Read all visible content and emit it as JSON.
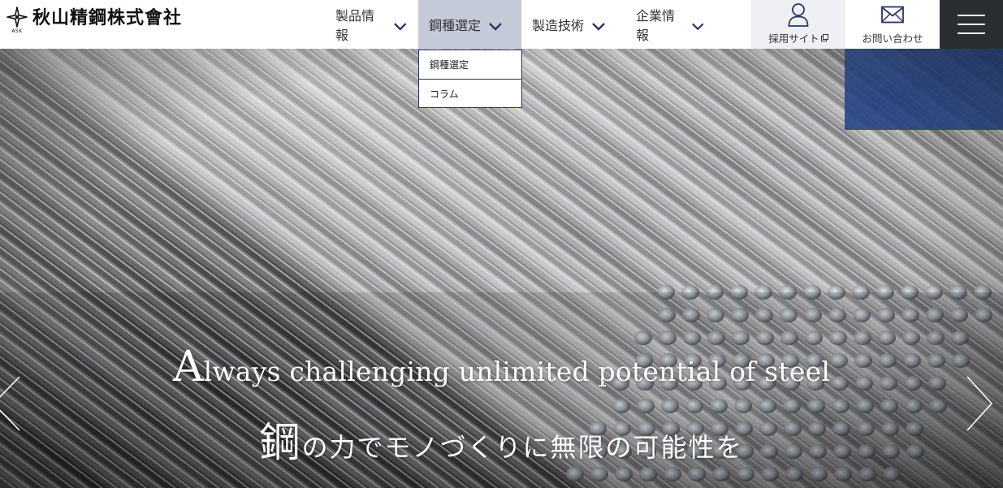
{
  "brand": {
    "abbr": "ASK",
    "name": "秋山精鋼株式會社"
  },
  "nav": {
    "items": [
      {
        "label": "製品情報"
      },
      {
        "label": "鋼種選定"
      },
      {
        "label": "製造技術"
      },
      {
        "label": "企業情報"
      }
    ],
    "active_index": 1
  },
  "dropdown": {
    "items": [
      {
        "label": "鋼種選定"
      },
      {
        "label": "コラム"
      }
    ]
  },
  "utility": {
    "recruit_label": "採用サイト",
    "contact_label": "お問い合わせ"
  },
  "hero": {
    "tagline_en_cap": "A",
    "tagline_en_rest": "lways challenging unlimited potential of steel",
    "tagline_jp_cap": "鋼",
    "tagline_jp_rest": "の力でモノづくりに無限の可能性を"
  },
  "icons": {
    "nav_chevron": "chevron-down-icon",
    "recruit": "user-icon",
    "contact": "mail-icon",
    "external": "external-link-icon",
    "menu": "hamburger-menu-icon",
    "prev": "chevron-left-icon",
    "next": "chevron-right-icon"
  },
  "colors": {
    "nav_active_bg": "#c4cad8",
    "dropdown_border": "#2b3466",
    "menu_bg": "#2a2e33",
    "recruit_bg": "#eef0f3",
    "icon_navy": "#2b3466"
  }
}
